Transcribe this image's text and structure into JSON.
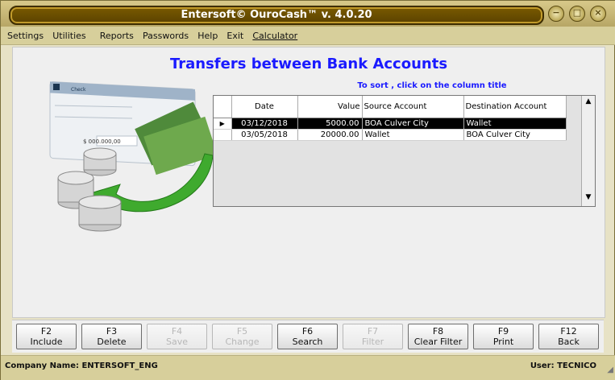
{
  "window": {
    "title": "Entersoft© OuroCash™ v. 4.0.20"
  },
  "menu": [
    "Settings",
    "Utilities",
    "Reports",
    "Passwords",
    "Help",
    "Exit",
    "Calculator"
  ],
  "page": {
    "title": "Transfers between Bank Accounts",
    "sort_hint": "To sort , click on the column title"
  },
  "grid": {
    "columns": [
      "Date",
      "Value",
      "Source Account",
      "Destination Account"
    ],
    "rows": [
      {
        "date": "03/12/2018",
        "value": "5000.00",
        "source": "BOA Culver City",
        "destination": "Wallet",
        "selected": true
      },
      {
        "date": "03/05/2018",
        "value": "20000.00",
        "source": "Wallet",
        "destination": "BOA Culver City",
        "selected": false
      }
    ]
  },
  "illustration": {
    "check_title": "Check",
    "check_amount": "$ 000.000,00"
  },
  "fkeys": [
    {
      "key": "F2",
      "label": "Include",
      "enabled": true
    },
    {
      "key": "F3",
      "label": "Delete",
      "enabled": true
    },
    {
      "key": "F4",
      "label": "Save",
      "enabled": false
    },
    {
      "key": "F5",
      "label": "Change",
      "enabled": false
    },
    {
      "key": "F6",
      "label": "Search",
      "enabled": true
    },
    {
      "key": "F7",
      "label": "Filter",
      "enabled": false
    },
    {
      "key": "F8",
      "label": "Clear Filter",
      "enabled": true
    },
    {
      "key": "F9",
      "label": "Print",
      "enabled": true
    },
    {
      "key": "F12",
      "label": "Back",
      "enabled": true
    }
  ],
  "status": {
    "company": "Company Name: ENTERSOFT_ENG",
    "user": "User: TECNICO"
  },
  "colors": {
    "title_blue": "#1a1aff",
    "selected_row": "#000000",
    "frame_gold": "#d7cf9b"
  }
}
